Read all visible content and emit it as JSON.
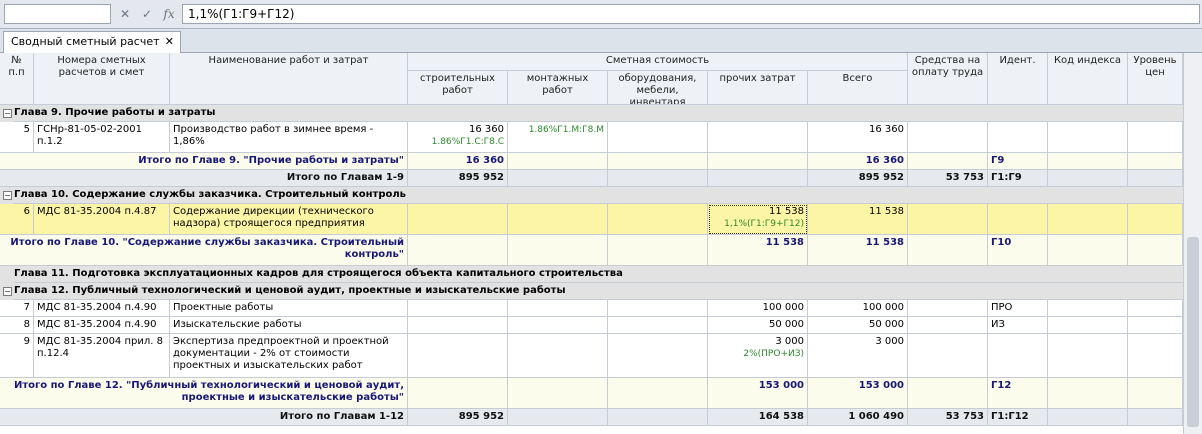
{
  "formula_bar": {
    "name_box": "",
    "cancel_icon": "✕",
    "accept_icon": "✓",
    "fx_label": "fx",
    "formula": "1,1%(Г1:Г9+Г12)"
  },
  "tab": {
    "label": "Сводный сметный расчет",
    "close": "✕"
  },
  "header": {
    "num": "№ п.п",
    "codes": "Номера сметных расчетов и смет",
    "name": "Наименование работ и затрат",
    "cost_group": "Сметная стоимость",
    "build": "строительных работ",
    "mount": "монтажных работ",
    "equip": "оборудования, мебели, инвентаря",
    "other": "прочих затрат",
    "total": "Всего",
    "salary": "Средства на оплату труда",
    "ident": "Идент.",
    "index_code": "Код индекса",
    "price_level": "Уровень цен"
  },
  "rows": [
    {
      "type": "chapter",
      "text": "Глава 9. Прочие работы и затраты"
    },
    {
      "type": "item",
      "num": "5",
      "code": "ГСНр-81-05-02-2001 п.1.2",
      "name": "Производство работ в зимнее время - 1,86%",
      "build": "16 360",
      "build_f": "1.86%Г1.С:Г8.С",
      "mount": "",
      "mount_f": "1.86%Г1.М:Г8.М",
      "equip": "",
      "other": "",
      "other_f": "",
      "total": "16 360",
      "salary": "",
      "ident": ""
    },
    {
      "type": "total",
      "label": "Итого по Главе 9. \"Прочие работы и затраты\"",
      "build": "16 360",
      "mount": "",
      "equip": "",
      "other": "",
      "total": "16 360",
      "salary": "",
      "ident": "Г9"
    },
    {
      "type": "grand",
      "label": "Итого по Главам 1-9",
      "build": "895 952",
      "mount": "",
      "equip": "",
      "other": "",
      "total": "895 952",
      "salary": "53 753",
      "ident": "Г1:Г9"
    },
    {
      "type": "chapter",
      "text": "Глава 10. Содержание службы заказчика. Строительный контроль"
    },
    {
      "type": "item",
      "selected": true,
      "num": "6",
      "code": "МДС 81-35.2004 п.4.87",
      "name": "Содержание дирекции (технического надзора) строящегося предприятия",
      "build": "",
      "build_f": "",
      "mount": "",
      "mount_f": "",
      "equip": "",
      "other": "11 538",
      "other_f": "1,1%(Г1:Г9+Г12)",
      "total": "11 538",
      "salary": "",
      "ident": ""
    },
    {
      "type": "total",
      "label": "Итого по Главе 10. \"Содержание службы заказчика. Строительный контроль\"",
      "build": "",
      "mount": "",
      "equip": "",
      "other": "11 538",
      "total": "11 538",
      "salary": "",
      "ident": "Г10"
    },
    {
      "type": "chapter",
      "text": "Глава 11. Подготовка эксплуатационных кадров для строящегося объекта капитального строительства",
      "no_toggle": true
    },
    {
      "type": "chapter",
      "text": "Глава 12. Публичный технологический и ценовой аудит, проектные и изыскательские работы"
    },
    {
      "type": "item",
      "num": "7",
      "code": "МДС 81-35.2004 п.4.90",
      "name": "Проектные работы",
      "build": "",
      "build_f": "",
      "mount": "",
      "mount_f": "",
      "equip": "",
      "other": "100 000",
      "other_f": "",
      "total": "100 000",
      "salary": "",
      "ident": "ПРО"
    },
    {
      "type": "item",
      "num": "8",
      "code": "МДС 81-35.2004 п.4.90",
      "name": "Изыскательские работы",
      "build": "",
      "build_f": "",
      "mount": "",
      "mount_f": "",
      "equip": "",
      "other": "50 000",
      "other_f": "",
      "total": "50 000",
      "salary": "",
      "ident": "ИЗ"
    },
    {
      "type": "item",
      "num": "9",
      "code": "МДС 81-35.2004 прил. 8 п.12.4",
      "name": "Экспертиза предпроектной и проектной документации - 2% от стоимости проектных и изыскательских работ",
      "build": "",
      "build_f": "",
      "mount": "",
      "mount_f": "",
      "equip": "",
      "other": "3 000",
      "other_f": "2%(ПРО+ИЗ)",
      "total": "3 000",
      "salary": "",
      "ident": ""
    },
    {
      "type": "total",
      "label": "Итого по Главе 12. \"Публичный технологический и ценовой аудит, проектные и изыскательские работы\"",
      "build": "",
      "mount": "",
      "equip": "",
      "other": "153 000",
      "total": "153 000",
      "salary": "",
      "ident": "Г12"
    },
    {
      "type": "grand",
      "label": "Итого по Главам 1-12",
      "build": "895 952",
      "mount": "",
      "equip": "",
      "other": "164 538",
      "total": "1 060 490",
      "salary": "53 753",
      "ident": "Г1:Г12"
    }
  ]
}
